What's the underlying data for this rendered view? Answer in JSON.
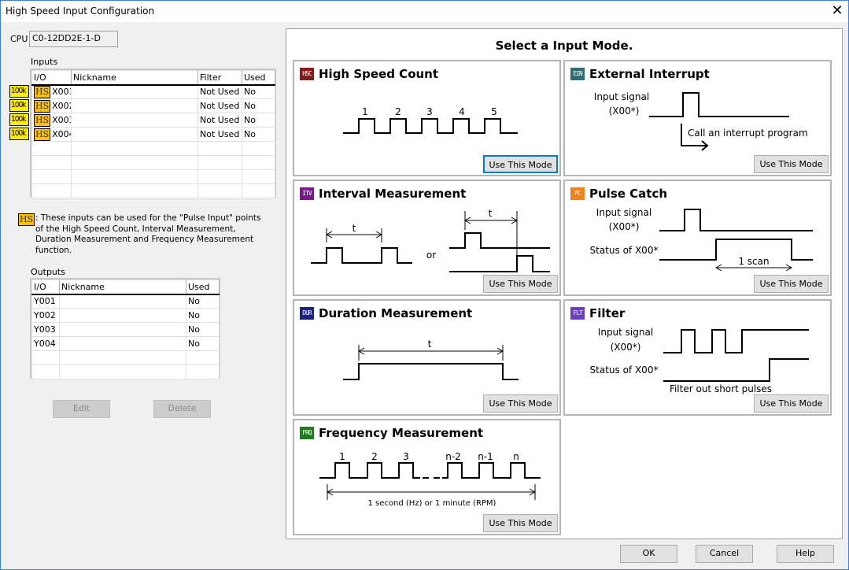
{
  "window": {
    "title": "High Speed Input Configuration",
    "close_icon": "close-icon"
  },
  "cpu": {
    "label": "CPU",
    "value": "C0-12DD2E-1-D"
  },
  "inputs": {
    "label": "Inputs",
    "columns": [
      "I/O",
      "Nickname",
      "Filter",
      "Used"
    ],
    "rows": [
      {
        "badge": "100k",
        "hs": "HS",
        "io": "X001",
        "nickname": "",
        "filter": "Not Used",
        "used": "No"
      },
      {
        "badge": "100k",
        "hs": "HS",
        "io": "X002",
        "nickname": "",
        "filter": "Not Used",
        "used": "No"
      },
      {
        "badge": "100k",
        "hs": "HS",
        "io": "X003",
        "nickname": "",
        "filter": "Not Used",
        "used": "No"
      },
      {
        "badge": "100k",
        "hs": "HS",
        "io": "X004",
        "nickname": "",
        "filter": "Not Used",
        "used": "No"
      }
    ]
  },
  "note": {
    "badge": "HS",
    "text": ": These inputs can be used for the \"Pulse Input\" points of the High Speed Count, Interval Measurement, Duration Measurement and Frequency Measurement function."
  },
  "outputs": {
    "label": "Outputs",
    "columns": [
      "I/O",
      "Nickname",
      "Used"
    ],
    "rows": [
      {
        "io": "Y001",
        "nickname": "",
        "used": "No"
      },
      {
        "io": "Y002",
        "nickname": "",
        "used": "No"
      },
      {
        "io": "Y003",
        "nickname": "",
        "used": "No"
      },
      {
        "io": "Y004",
        "nickname": "",
        "used": "No"
      }
    ]
  },
  "buttons": {
    "edit": "Edit",
    "delete": "Delete",
    "ok": "OK",
    "cancel": "Cancel",
    "help": "Help"
  },
  "panel": {
    "title": "Select a Input Mode.",
    "use_label": "Use This Mode",
    "modes": [
      {
        "icon": "HSC",
        "color": "#8b1a1a",
        "title": "High Speed Count",
        "labels": [
          "1",
          "2",
          "3",
          "4",
          "5"
        ]
      },
      {
        "icon": "EIN",
        "color": "#2f6b73",
        "title": "External Interrupt",
        "labels": [
          "Input signal",
          "(X00*)",
          "Call an interrupt program"
        ]
      },
      {
        "icon": "ITV",
        "color": "#7a1a8a",
        "title": "Interval Measurement",
        "labels": [
          "t",
          "or",
          "t"
        ]
      },
      {
        "icon": "PC",
        "color": "#f08020",
        "title": "Pulse Catch",
        "labels": [
          "Input signal",
          "(X00*)",
          "Status of X00*",
          "1 scan"
        ]
      },
      {
        "icon": "DUR",
        "color": "#1a237e",
        "title": "Duration Measurement",
        "labels": [
          "t"
        ]
      },
      {
        "icon": "FLT",
        "color": "#6a3fc0",
        "title": "Filter",
        "labels": [
          "Input signal",
          "(X00*)",
          "Status of X00*",
          "Filter out short pulses"
        ]
      },
      {
        "icon": "FRQ",
        "color": "#1e7b1e",
        "title": "Frequency Measurement",
        "labels": [
          "1",
          "2",
          "3",
          "n-2",
          "n-1",
          "n",
          "1 second (Hz) or 1 minute (RPM)"
        ]
      }
    ]
  }
}
